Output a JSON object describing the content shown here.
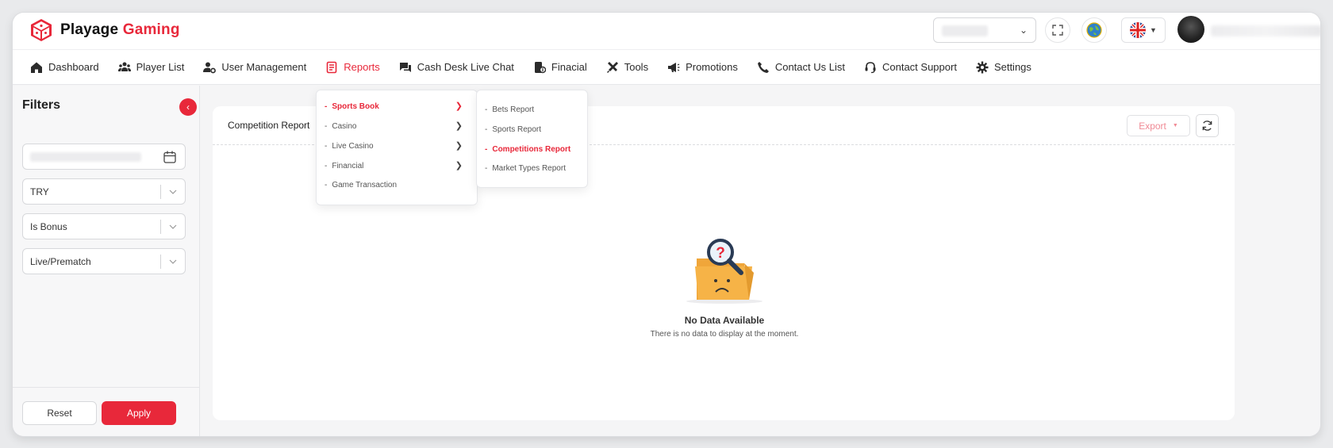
{
  "brand": {
    "name_part1": "Playage",
    "name_part2": "Gaming",
    "accent": "#e8283a"
  },
  "nav": [
    {
      "label": "Dashboard",
      "icon": "home-icon"
    },
    {
      "label": "Player List",
      "icon": "users-icon"
    },
    {
      "label": "User Management",
      "icon": "user-gear-icon"
    },
    {
      "label": "Reports",
      "icon": "report-icon",
      "active": true
    },
    {
      "label": "Cash Desk Live Chat",
      "icon": "chat-icon"
    },
    {
      "label": "Finacial",
      "icon": "money-icon"
    },
    {
      "label": "Tools",
      "icon": "tools-icon"
    },
    {
      "label": "Promotions",
      "icon": "megaphone-icon"
    },
    {
      "label": "Contact Us List",
      "icon": "phone-icon"
    },
    {
      "label": "Contact Support",
      "icon": "headset-icon"
    },
    {
      "label": "Settings",
      "icon": "gear-icon"
    }
  ],
  "reports_menu": [
    {
      "label": "Sports Book",
      "has_sub": true,
      "active": true
    },
    {
      "label": "Casino",
      "has_sub": true
    },
    {
      "label": "Live Casino",
      "has_sub": true
    },
    {
      "label": "Financial",
      "has_sub": true
    },
    {
      "label": "Game Transaction",
      "has_sub": false
    }
  ],
  "sportsbook_submenu": [
    {
      "label": "Bets Report"
    },
    {
      "label": "Sports Report"
    },
    {
      "label": "Competitions Report",
      "active": true
    },
    {
      "label": "Market Types Report"
    }
  ],
  "filters": {
    "title": "Filters",
    "currency": "TRY",
    "bonus_placeholder": "Is Bonus",
    "live_placeholder": "Live/Prematch",
    "reset_label": "Reset",
    "apply_label": "Apply"
  },
  "report": {
    "title": "Competition Report",
    "export_label": "Export",
    "empty_title": "No Data Available",
    "empty_subtitle": "There is no data to display at the moment."
  }
}
